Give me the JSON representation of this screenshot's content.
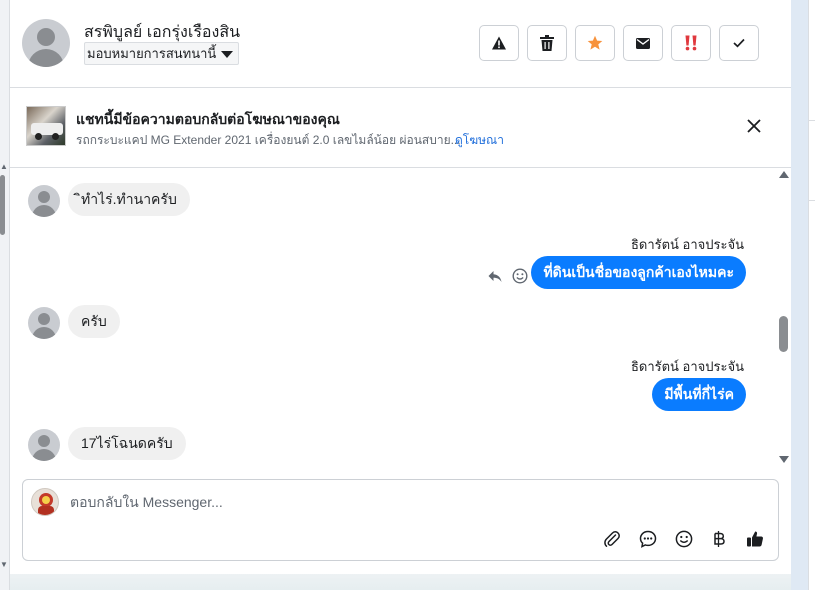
{
  "header": {
    "contact_name": "สรพิบูลย์ เอกรุ่งเรืองสิน",
    "assign_label": "มอบหมายการสนทนานี้",
    "actions": [
      {
        "name": "spam",
        "icon": "warning-icon"
      },
      {
        "name": "delete",
        "icon": "trash-icon"
      },
      {
        "name": "star",
        "icon": "star-icon",
        "color": "#f7923b"
      },
      {
        "name": "mark-unread",
        "icon": "envelope-icon"
      },
      {
        "name": "follow-up",
        "icon": "double-exclamation-icon",
        "color": "#e0393e"
      },
      {
        "name": "done",
        "icon": "checkmark-icon"
      }
    ]
  },
  "ad_banner": {
    "title": "แชทนี้มีข้อความตอบกลับต่อโฆษณาของคุณ",
    "description": "รถกระบะแคป MG Extender 2021 เครื่องยนต์ 2.0 เลขไมล์น้อย ผ่อนสบาย...",
    "link_label": "ดูโฆษณา"
  },
  "messages": [
    {
      "direction": "in",
      "text": "ิทำไร่.ทำนาครับ"
    },
    {
      "direction": "out",
      "sender": "ธิดารัตน์ อาจประจัน",
      "text": "ที่ดินเป็นชื่อของลูกค้าเองไหมคะ"
    },
    {
      "direction": "in",
      "text": "ครับ"
    },
    {
      "direction": "out",
      "sender": "ธิดารัตน์ อาจประจัน",
      "text": "มีพื้นที่กี่ไร่ค"
    },
    {
      "direction": "in",
      "text": "17ไร่โฉนดครับ"
    }
  ],
  "composer": {
    "placeholder": "ตอบกลับใน Messenger...",
    "tools": [
      "attachment-icon",
      "saved-reply-icon",
      "emoji-icon",
      "baht-payment-icon",
      "thumbs-up-icon"
    ]
  },
  "colors": {
    "outgoing_bubble": "#0a7cff",
    "incoming_bubble": "#f0f0f0",
    "link": "#216fdb"
  }
}
